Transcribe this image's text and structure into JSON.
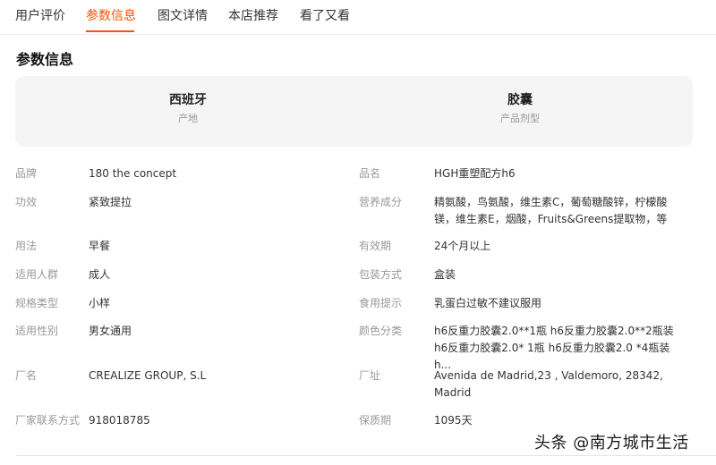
{
  "tabs": [
    {
      "label": "用户评价"
    },
    {
      "label": "参数信息"
    },
    {
      "label": "图文详情"
    },
    {
      "label": "本店推荐"
    },
    {
      "label": "看了又看"
    }
  ],
  "active_tab": "参数信息",
  "section_title": "参数信息",
  "summary": [
    {
      "value": "西班牙",
      "label": "产地"
    },
    {
      "value": "胶囊",
      "label": "产品剂型"
    }
  ],
  "params_left": [
    {
      "key": "品牌",
      "value": "180 the concept"
    },
    {
      "key": "功效",
      "value": "紧致提拉"
    },
    {
      "key": "用法",
      "value": "早餐"
    },
    {
      "key": "适用人群",
      "value": "成人"
    },
    {
      "key": "规格类型",
      "value": "小样"
    },
    {
      "key": "适用性别",
      "value": "男女通用"
    },
    {
      "key": "厂名",
      "value": "CREALIZE GROUP, S.L"
    },
    {
      "key": "厂家联系方式",
      "value": "918018785"
    }
  ],
  "params_right": [
    {
      "key": "品名",
      "value": "HGH重塑配方h6"
    },
    {
      "key": "营养成分",
      "value": "精氨酸，鸟氨酸，维生素C，葡萄糖酸锌，柠檬酸镁，维生素E，烟酸，Fruits&Greens提取物，等"
    },
    {
      "key": "有效期",
      "value": "24个月以上"
    },
    {
      "key": "包装方式",
      "value": "盒装"
    },
    {
      "key": "食用提示",
      "value": "乳蛋白过敏不建议服用"
    },
    {
      "key": "颜色分类",
      "value": "h6反重力胶囊2.0**1瓶 h6反重力胶囊2.0**2瓶装 h6反重力胶囊2.0* 1瓶 h6反重力胶囊2.0 *4瓶装 h..."
    },
    {
      "key": "厂址",
      "value": "Avenida de Madrid,23 , Valdemoro, 28342, Madrid"
    },
    {
      "key": "保质期",
      "value": "1095天"
    }
  ],
  "watermark": "头条 @南方城市生活"
}
